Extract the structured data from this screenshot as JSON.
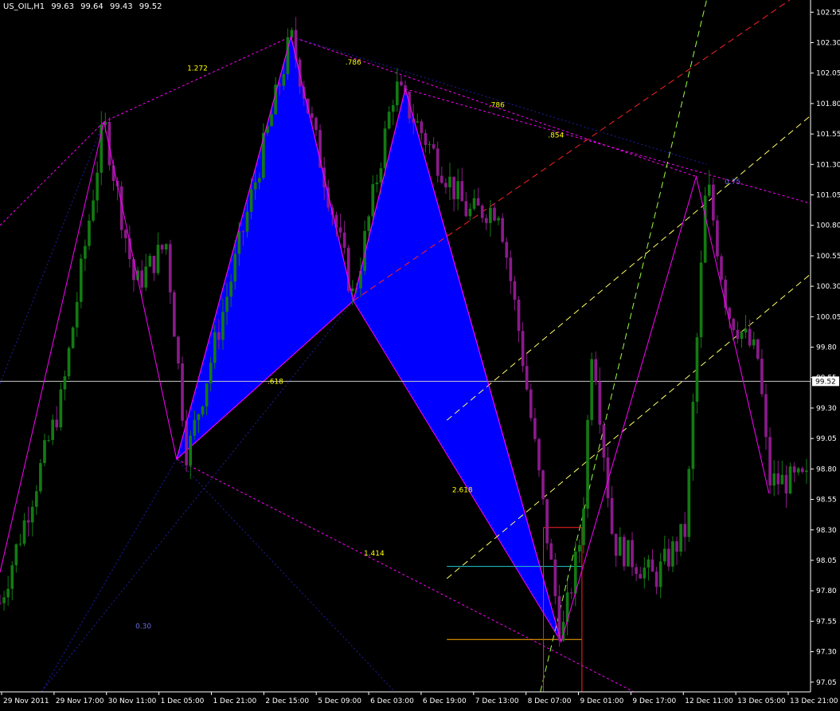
{
  "header": {
    "symbol": "US_OIL,H1",
    "open": "99.63",
    "high": "99.64",
    "low": "99.43",
    "close": "99.52"
  },
  "colors": {
    "background": "#000000",
    "axis": "#ffffff",
    "bull": "#137a13",
    "bear": "#8b1a8b",
    "pattern_fill": "#0000ff",
    "pattern_edge": "#ff00ff",
    "fib_label": "#ffff00",
    "trend_yellow": "#ffff66",
    "trend_red": "#ff2222",
    "trend_green": "#99ff44",
    "channel_blue": "#1a1a8a",
    "cyan_line": "#22cccc",
    "orange_line": "#ffaa00"
  },
  "chart_data": {
    "type": "candlestick",
    "symbol": "US_OIL",
    "timeframe": "H1",
    "current_price": 99.52,
    "current_price_label": "99.52",
    "ylim": [
      96.97,
      102.65
    ],
    "y_ticks": [
      "102.55",
      "102.30",
      "102.05",
      "101.80",
      "101.55",
      "101.30",
      "101.05",
      "100.80",
      "100.55",
      "100.30",
      "100.05",
      "99.80",
      "99.55",
      "99.30",
      "99.05",
      "98.80",
      "98.55",
      "98.30",
      "98.05",
      "97.80",
      "97.55",
      "97.30",
      "97.05"
    ],
    "x_ticks": [
      "29 Nov 2011",
      "29 Nov 17:00",
      "30 Nov 11:00",
      "1 Dec 05:00",
      "1 Dec 21:00",
      "2 Dec 15:00",
      "5 Dec 09:00",
      "6 Dec 03:00",
      "6 Dec 19:00",
      "7 Dec 13:00",
      "8 Dec 07:00",
      "9 Dec 01:00",
      "9 Dec 17:00",
      "12 Dec 11:00",
      "13 Dec 05:00",
      "13 Dec 21:00"
    ],
    "price_path": [
      [
        0,
        97.7
      ],
      [
        6,
        99.4
      ],
      [
        10,
        101.65
      ],
      [
        13,
        100.3
      ],
      [
        16,
        100.65
      ],
      [
        18,
        98.9
      ],
      [
        28,
        102.35
      ],
      [
        34,
        100.2
      ],
      [
        38,
        101.95
      ],
      [
        45,
        100.9
      ],
      [
        48,
        100.95
      ],
      [
        50,
        99.9
      ],
      [
        54,
        97.4
      ],
      [
        56,
        98.3
      ],
      [
        57,
        99.9
      ],
      [
        59,
        98.2
      ],
      [
        63,
        97.9
      ],
      [
        66,
        98.3
      ],
      [
        68,
        101.2
      ],
      [
        70,
        100.1
      ],
      [
        73,
        99.7
      ],
      [
        74,
        98.7
      ]
    ],
    "zigzag": [
      [
        0,
        97.95
      ],
      [
        10,
        101.65
      ],
      [
        17,
        98.88
      ],
      [
        28,
        102.35
      ],
      [
        34,
        100.18
      ],
      [
        39,
        101.92
      ],
      [
        54,
        97.38
      ],
      [
        67,
        101.2
      ],
      [
        74,
        98.6
      ]
    ],
    "harmonic_pattern": {
      "X": [
        17,
        98.88
      ],
      "A": [
        28,
        102.35
      ],
      "B": [
        34,
        100.18
      ],
      "C": [
        39,
        101.92
      ],
      "D": [
        54,
        97.38
      ],
      "ratio_labels": [
        {
          "text": "1.272",
          "at": [
            19,
            102.07
          ]
        },
        {
          "text": ".786",
          "at": [
            34,
            102.12
          ]
        },
        {
          "text": ".786",
          "at": [
            47.8,
            101.77
          ]
        },
        {
          "text": ".854",
          "at": [
            53.5,
            101.52
          ]
        },
        {
          "text": ".618",
          "at": [
            26.5,
            99.5
          ]
        },
        {
          "text": "2.618",
          "at": [
            44.5,
            98.61
          ]
        },
        {
          "text": "1.414",
          "at": [
            36,
            98.09
          ]
        },
        {
          "text": "0.75",
          "at": [
            70.5,
            101.14
          ]
        },
        {
          "text": "0.30",
          "at": [
            13.8,
            97.49
          ]
        }
      ]
    }
  }
}
